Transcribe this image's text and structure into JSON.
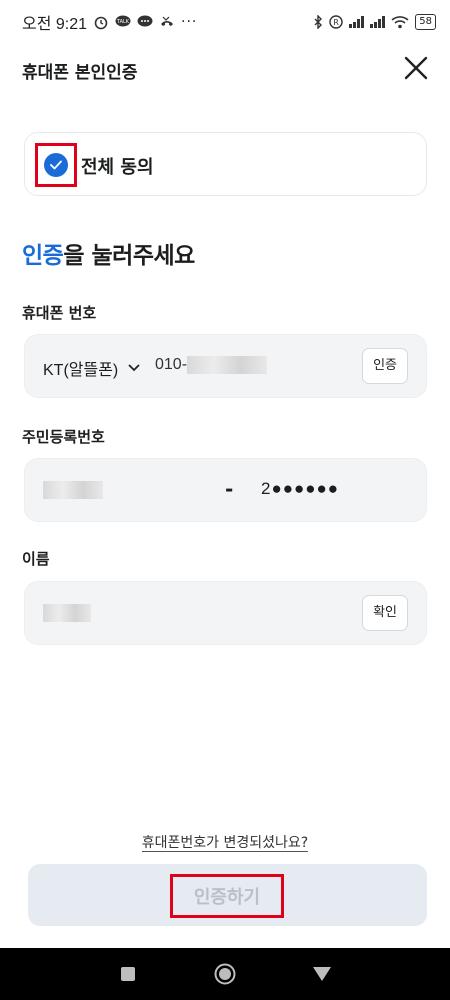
{
  "status_bar": {
    "time": "오전 9:21",
    "battery": "58",
    "icons": [
      "alarm-icon",
      "talk-icon",
      "message-icon",
      "missed-call-icon",
      "more-icon",
      "bluetooth-icon",
      "roaming-icon",
      "signal-icon",
      "signal-icon",
      "wifi-icon",
      "battery-icon"
    ]
  },
  "header": {
    "title": "휴대폰 본인인증",
    "close_icon": "close-icon"
  },
  "agree_all": {
    "label": "전체 동의",
    "checked": true
  },
  "headline": {
    "accent": "인증",
    "rest": "을 눌러주세요"
  },
  "phone": {
    "label": "휴대폰 번호",
    "carrier": "KT(알뜰폰)",
    "number_prefix": "010-",
    "button": "인증"
  },
  "rrn": {
    "label": "주민등록번호",
    "dash": "-",
    "back": "2●●●●●●"
  },
  "name": {
    "label": "이름",
    "button": "확인"
  },
  "change_link": "휴대폰번호가 변경되셨나요?",
  "submit": "인증하기",
  "colors": {
    "accent": "#1a6bd8",
    "highlight_box": "#e0001a",
    "field_bg": "#f3f4f6",
    "submit_bg": "#e6ebf2",
    "submit_text": "#b9c0c9"
  },
  "nav": [
    "recent-apps-icon",
    "home-icon",
    "back-icon"
  ]
}
